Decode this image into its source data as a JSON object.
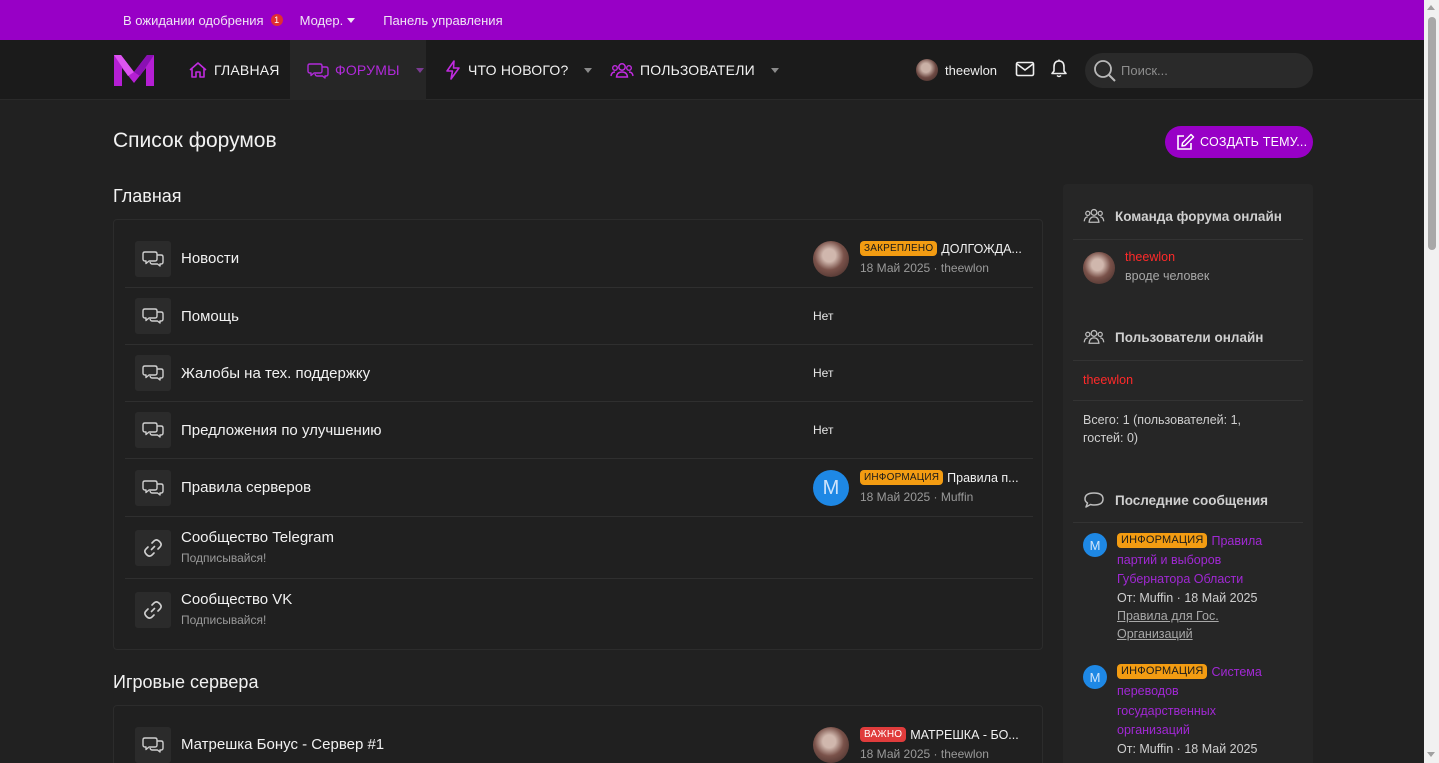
{
  "topbar": {
    "pending": "В ожидании одобрения",
    "pending_count": "1",
    "moder": "Модер.",
    "panel": "Панель управления"
  },
  "nav": {
    "home": "ГЛАВНАЯ",
    "forums": "ФОРУМЫ",
    "whats_new": "ЧТО НОВОГО?",
    "users": "ПОЛЬЗОВАТЕЛИ",
    "username": "theewlon",
    "search_placeholder": "Поиск..."
  },
  "colors": {
    "accent": "#9800c6",
    "accent_text": "#b02ad9",
    "staff_name": "#ff2a2a",
    "label_info": "#f39c12",
    "label_important": "#e03c3c"
  },
  "page": {
    "title": "Список форумов",
    "create_button": "СОЗДАТЬ ТЕМУ..."
  },
  "sections": [
    {
      "title": "Главная",
      "forums": [
        {
          "name": "Новости",
          "icon": "chat-icon",
          "last": {
            "label": "ЗАКРЕПЛЕНО",
            "title": "ДОЛГОЖДА...",
            "date": "18 Май 2025",
            "author": "theewlon"
          }
        },
        {
          "name": "Помощь",
          "icon": "chat-icon",
          "none": "Нет"
        },
        {
          "name": "Жалобы на тех. поддержку",
          "icon": "chat-icon",
          "none": "Нет"
        },
        {
          "name": "Предложения по улучшению",
          "icon": "chat-icon",
          "none": "Нет"
        },
        {
          "name": "Правила серверов",
          "icon": "chat-icon",
          "last": {
            "label": "ИНФОРМАЦИЯ",
            "title": "Правила п...",
            "date": "18 Май 2025",
            "author": "Muffin",
            "avatar_letter": "M"
          }
        },
        {
          "name": "Сообщество Telegram",
          "icon": "link-icon",
          "desc": "Подписывайся!"
        },
        {
          "name": "Сообщество VK",
          "icon": "link-icon",
          "desc": "Подписывайся!"
        }
      ]
    },
    {
      "title": "Игровые сервера",
      "forums": [
        {
          "name": "Матрешка Бонус - Сервер #1",
          "icon": "chat-icon",
          "last": {
            "label": "ВАЖНО",
            "title": "МАТРЕШКА - БО...",
            "date": "18 Май 2025",
            "author": "theewlon"
          }
        }
      ]
    }
  ],
  "sidebar": {
    "staff_title": "Команда форума онлайн",
    "staff_name": "theewlon",
    "staff_status": "вроде человек",
    "online_title": "Пользователи онлайн",
    "online_name": "theewlon",
    "total_line1": "Всего: 1 (пользователей: 1,",
    "total_line2": "гостей: 0)",
    "latest_title": "Последние сообщения",
    "posts": [
      {
        "avatar_letter": "M",
        "label": "ИНФОРМАЦИЯ",
        "title_l1": "Правила",
        "title_l2": "партий и выборов",
        "title_l3": "Губернатора Области",
        "meta": "От: Muffin · 18 Май 2025",
        "forum_l1": "Правила для Гос.",
        "forum_l2": "Организаций"
      },
      {
        "avatar_letter": "M",
        "label": "ИНФОРМАЦИЯ",
        "title_l1": "Система",
        "title_l2": "переводов",
        "title_l3": "государственных",
        "title_l4": "организаций",
        "meta": "От: Muffin · 18 Май 2025"
      }
    ]
  }
}
